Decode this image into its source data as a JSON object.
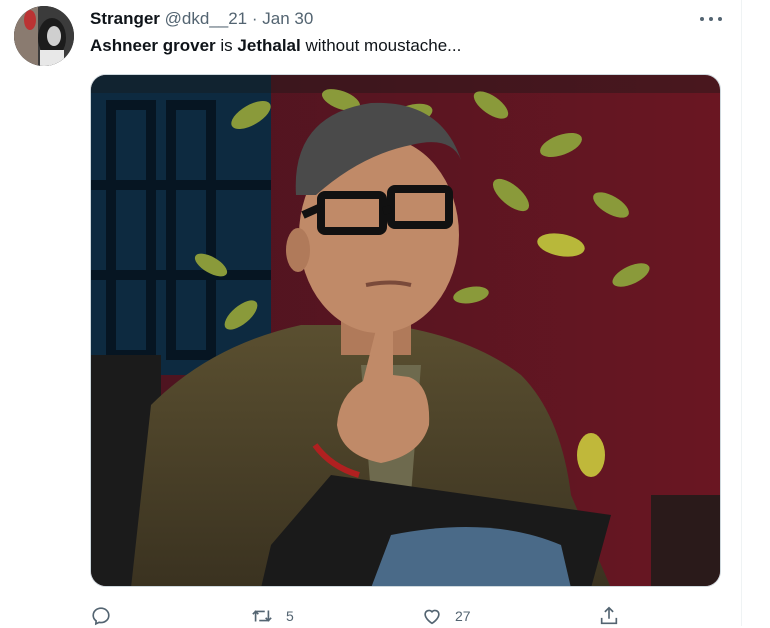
{
  "tweet": {
    "author_name": "Stranger",
    "handle": "@dkd__21",
    "separator": "·",
    "date": "Jan 30",
    "text": {
      "part1": "Ashneer grover",
      "part2": " is ",
      "part3": "Jethalal",
      "part4": " without moustache..."
    },
    "media_alt": "Man in glasses and olive suede jacket raising index finger on a TV show set"
  },
  "actions": {
    "reply": {
      "icon": "reply-icon",
      "count": ""
    },
    "retweet": {
      "icon": "retweet-icon",
      "count": "5"
    },
    "like": {
      "icon": "heart-icon",
      "count": "27"
    },
    "share": {
      "icon": "share-icon",
      "count": ""
    }
  },
  "colors": {
    "text": "#0f1419",
    "secondary": "#536471",
    "border": "#cfd9de"
  }
}
